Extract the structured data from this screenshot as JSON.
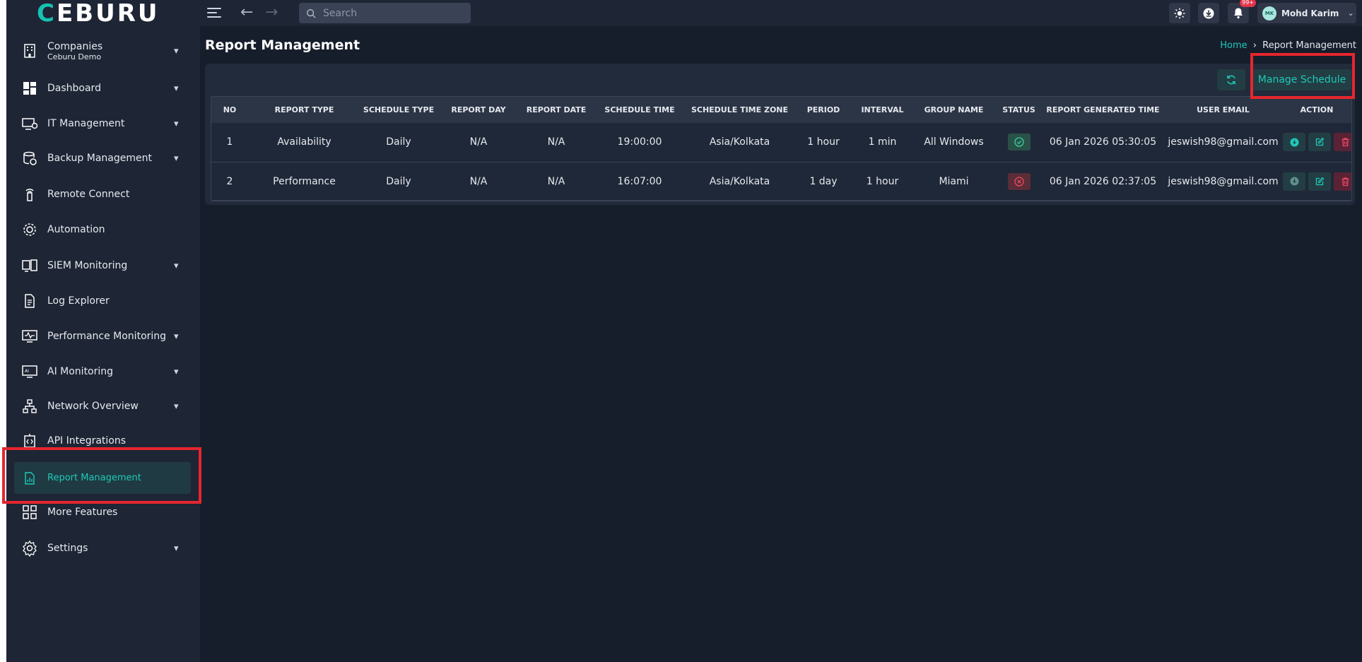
{
  "brand": {
    "logo_first": "C",
    "logo_rest": "EBURU"
  },
  "topbar": {
    "search_placeholder": "Search",
    "notification_count": "99+",
    "user_initials": "MK",
    "user_name": "Mohd Karim"
  },
  "sidebar": {
    "items": [
      {
        "label": "Companies",
        "sub": "Ceburu Demo",
        "icon": "building-icon",
        "chevron": true
      },
      {
        "label": "Dashboard",
        "icon": "dashboard-icon",
        "chevron": true
      },
      {
        "label": "IT Management",
        "icon": "it-management-icon",
        "chevron": true
      },
      {
        "label": "Backup Management",
        "icon": "backup-icon",
        "chevron": true
      },
      {
        "label": "Remote Connect",
        "icon": "remote-icon",
        "chevron": false
      },
      {
        "label": "Automation",
        "icon": "automation-icon",
        "chevron": false
      },
      {
        "label": "SIEM Monitoring",
        "icon": "siem-icon",
        "chevron": true
      },
      {
        "label": "Log Explorer",
        "icon": "log-file-icon",
        "chevron": false
      },
      {
        "label": "Performance Monitoring",
        "icon": "performance-monitor-icon",
        "chevron": true
      },
      {
        "label": "AI Monitoring",
        "icon": "ai-monitor-icon",
        "chevron": true
      },
      {
        "label": "Network Overview",
        "icon": "network-icon",
        "chevron": true
      },
      {
        "label": "API Integrations",
        "icon": "api-icon",
        "chevron": false
      },
      {
        "label": "Report Management",
        "icon": "report-icon",
        "chevron": false,
        "active": true
      },
      {
        "label": "More Features",
        "icon": "grid-icon",
        "chevron": false
      },
      {
        "label": "Settings",
        "icon": "gear-icon",
        "chevron": true
      }
    ]
  },
  "page": {
    "title": "Report Management",
    "breadcrumb_home": "Home",
    "breadcrumb_sep": "›",
    "breadcrumb_current": "Report Management",
    "manage_schedule_label": "Manage Schedule"
  },
  "table": {
    "headers": [
      "NO",
      "REPORT TYPE",
      "SCHEDULE TYPE",
      "REPORT DAY",
      "REPORT DATE",
      "SCHEDULE TIME",
      "SCHEDULE TIME ZONE",
      "PERIOD",
      "INTERVAL",
      "GROUP NAME",
      "STATUS",
      "REPORT GENERATED TIME",
      "USER EMAIL",
      "ACTION"
    ],
    "rows": [
      {
        "no": "1",
        "report_type": "Availability",
        "schedule_type": "Daily",
        "report_day": "N/A",
        "report_date": "N/A",
        "schedule_time": "19:00:00",
        "time_zone": "Asia/Kolkata",
        "period": "1 hour",
        "interval": "1 min",
        "group_name": "All Windows",
        "status": "success",
        "generated_time": "06 Jan 2026 05:30:05",
        "email": "jeswish98@gmail.com"
      },
      {
        "no": "2",
        "report_type": "Performance",
        "schedule_type": "Daily",
        "report_day": "N/A",
        "report_date": "N/A",
        "schedule_time": "16:07:00",
        "time_zone": "Asia/Kolkata",
        "period": "1 day",
        "interval": "1 hour",
        "group_name": "Miami",
        "status": "failed",
        "generated_time": "06 Jan 2026 02:37:05",
        "email": "jeswish98@gmail.com"
      }
    ]
  },
  "colors": {
    "accent": "#1fc9b7",
    "annotation": "#e6262e",
    "background": "#161d2b",
    "sidebar": "#1e2535"
  }
}
